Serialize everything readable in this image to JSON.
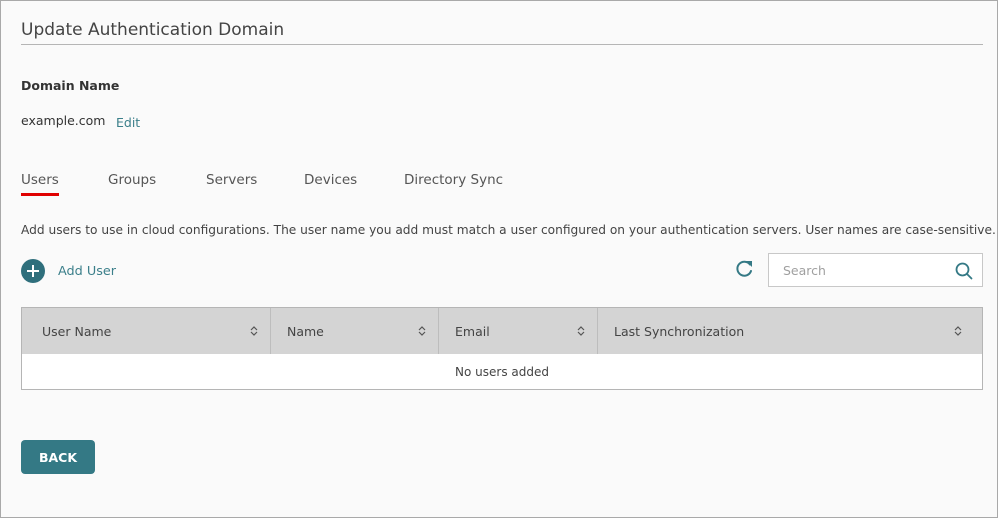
{
  "page": {
    "title": "Update Authentication Domain"
  },
  "domain": {
    "label": "Domain Name",
    "value": "example.com",
    "edit_label": "Edit"
  },
  "tabs": [
    {
      "label": "Users",
      "active": true
    },
    {
      "label": "Groups",
      "active": false
    },
    {
      "label": "Servers",
      "active": false
    },
    {
      "label": "Devices",
      "active": false
    },
    {
      "label": "Directory Sync",
      "active": false
    }
  ],
  "users": {
    "description": "Add users to use in cloud configurations. The user name you add must match a user configured on your authentication servers. User names are case-sensitive.",
    "add_user_label": "Add User",
    "add_user_icon": "plus-circle-icon",
    "refresh_icon": "refresh-icon",
    "search": {
      "placeholder": "Search",
      "value": "",
      "icon": "search-icon"
    },
    "table": {
      "columns": [
        {
          "label": "User Name",
          "sort_icon": "sort-icon"
        },
        {
          "label": "Name",
          "sort_icon": "sort-icon"
        },
        {
          "label": "Email",
          "sort_icon": "sort-icon"
        },
        {
          "label": "Last Synchronization",
          "sort_icon": "sort-icon"
        }
      ],
      "empty_message": "No users added"
    }
  },
  "footer": {
    "back_label": "BACK"
  },
  "colors": {
    "accent": "#347985",
    "link": "#3b7f8a",
    "active_tab_underline": "#e00000",
    "table_header_bg": "#d4d4d4"
  }
}
